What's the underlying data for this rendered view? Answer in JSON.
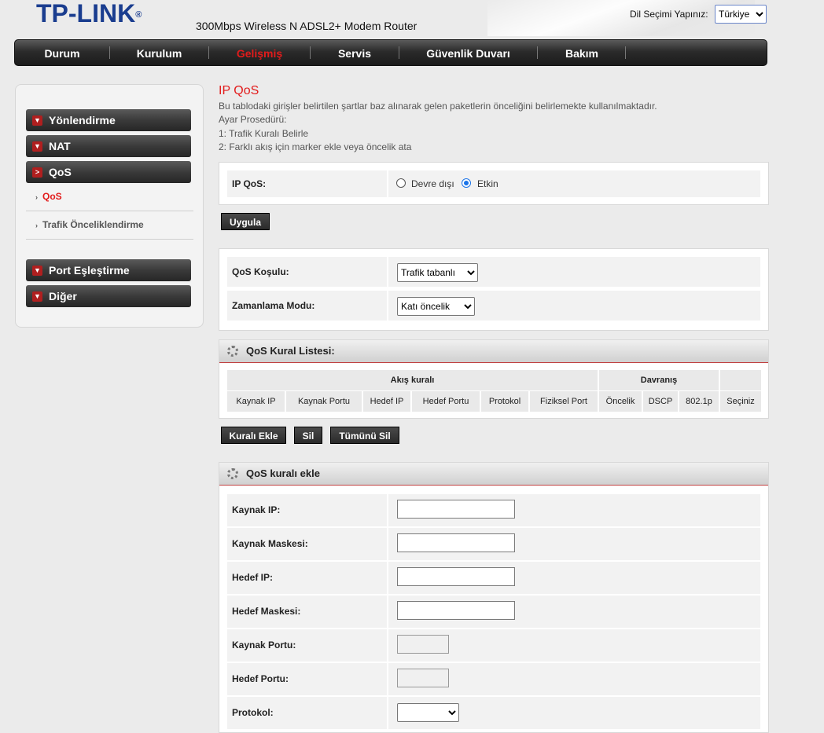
{
  "header": {
    "brand": "TP-LINK",
    "model": "300Mbps Wireless N ADSL2+ Modem Router",
    "lang_label": "Dil Seçimi Yapınız:",
    "lang_value": "Türkiye"
  },
  "nav": [
    "Durum",
    "Kurulum",
    "Gelişmiş",
    "Servis",
    "Güvenlik Duvarı",
    "Bakım"
  ],
  "nav_active": "Gelişmiş",
  "sidebar": {
    "items": [
      "Yönlendirme",
      "NAT",
      "QoS"
    ],
    "sub_items": [
      "QoS",
      "Trafik Önceliklendirme"
    ],
    "items2": [
      "Port Eşleştirme",
      "Diğer"
    ]
  },
  "page": {
    "title": "IP QoS",
    "desc": [
      "Bu tablodaki girişler belirtilen şartlar baz alınarak gelen paketlerin önceliğini belirlemekte kullanılmaktadır.",
      "Ayar Prosedürü:",
      "1: Trafik Kuralı Belirle",
      "2: Farklı akış için marker ekle veya öncelik ata"
    ]
  },
  "ipqos": {
    "label": "IP QoS:",
    "opt_off": "Devre dışı",
    "opt_on": "Etkin",
    "selected": "Etkin",
    "apply": "Uygula"
  },
  "settings": {
    "cond_label": "QoS Koşulu:",
    "cond_value": "Trafik tabanlı",
    "sched_label": "Zamanlama Modu:",
    "sched_value": "Katı öncelik"
  },
  "rule_list": {
    "title": "QoS Kural Listesi:",
    "group1": "Akış kuralı",
    "group2": "Davranış",
    "columns": [
      "Kaynak IP",
      "Kaynak Portu",
      "Hedef IP",
      "Hedef Portu",
      "Protokol",
      "Fiziksel Port",
      "Öncelik",
      "DSCP",
      "802.1p",
      "Seçiniz"
    ],
    "btn_add": "Kuralı Ekle",
    "btn_del": "Sil",
    "btn_del_all": "Tümünü Sil"
  },
  "add_rule": {
    "title": "QoS kuralı ekle",
    "fields": [
      "Kaynak IP:",
      "Kaynak Maskesi:",
      "Hedef IP:",
      "Hedef Maskesi:",
      "Kaynak Portu:",
      "Hedef Portu:",
      "Protokol:"
    ]
  }
}
